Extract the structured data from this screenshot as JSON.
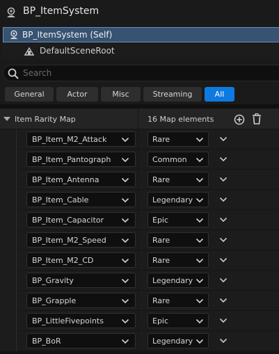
{
  "header": {
    "title": "BP_ItemSystem",
    "icon": "pawn-icon"
  },
  "tree": {
    "self_label": "BP_ItemSystem (Self)",
    "root_label": "DefaultSceneRoot"
  },
  "search": {
    "placeholder": "Search",
    "value": ""
  },
  "filters": [
    {
      "label": "General",
      "active": false
    },
    {
      "label": "Actor",
      "active": false
    },
    {
      "label": "Misc",
      "active": false
    },
    {
      "label": "Streaming",
      "active": false
    },
    {
      "label": "All",
      "active": true
    }
  ],
  "map": {
    "name": "Item Rarity Map",
    "count_label": "16 Map elements",
    "entries": [
      {
        "key": "BP_Item_M2_Attack",
        "value": "Rare"
      },
      {
        "key": "BP_Item_Pantograph",
        "value": "Common"
      },
      {
        "key": "BP_Item_Antenna",
        "value": "Rare"
      },
      {
        "key": "BP_Item_Cable",
        "value": "Legendary"
      },
      {
        "key": "BP_Item_Capacitor",
        "value": "Epic"
      },
      {
        "key": "BP_Item_M2_Speed",
        "value": "Rare"
      },
      {
        "key": "BP_Item_M2_CD",
        "value": "Rare"
      },
      {
        "key": "BP_Gravity",
        "value": "Legendary"
      },
      {
        "key": "BP_Grapple",
        "value": "Rare"
      },
      {
        "key": "BP_LittleFivepoints",
        "value": "Epic"
      },
      {
        "key": "BP_BoR",
        "value": "Legendary"
      }
    ]
  },
  "colors": {
    "accent": "#0e7ae0",
    "selection": "#385271"
  }
}
